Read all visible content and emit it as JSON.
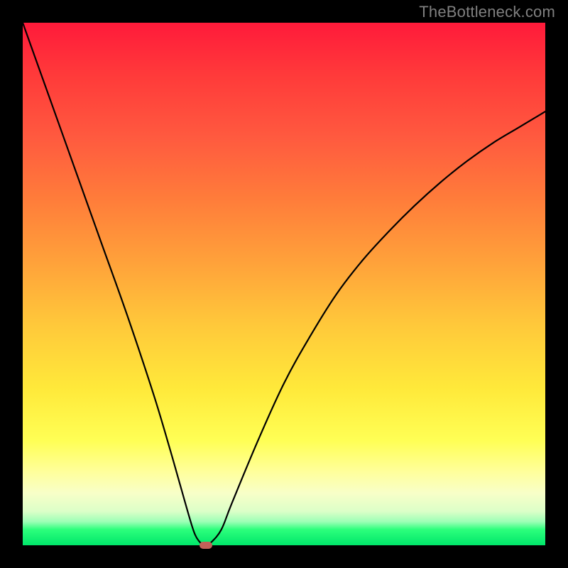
{
  "watermark": "TheBottleneck.com",
  "colors": {
    "background": "#000000",
    "gradient_top": "#ff1a3a",
    "gradient_bottom": "#00e66a",
    "curve_stroke": "#000000",
    "marker_fill": "#c26059",
    "watermark_text": "#808080"
  },
  "chart_data": {
    "type": "line",
    "title": "",
    "xlabel": "",
    "ylabel": "",
    "xlim": [
      0,
      100
    ],
    "ylim": [
      0,
      100
    ],
    "grid": false,
    "legend": false,
    "series": [
      {
        "name": "bottleneck-curve",
        "x": [
          0,
          5,
          10,
          15,
          20,
          25,
          28,
          30,
          32,
          33,
          34,
          35,
          36,
          38,
          40,
          45,
          50,
          55,
          60,
          65,
          70,
          75,
          80,
          85,
          90,
          95,
          100
        ],
        "values": [
          100,
          86,
          72,
          58,
          44,
          29,
          19,
          12,
          5,
          2,
          0.5,
          0,
          0.5,
          3,
          8,
          20,
          31,
          40,
          48,
          54.5,
          60,
          65,
          69.5,
          73.5,
          77,
          80,
          83
        ]
      }
    ],
    "annotations": [
      {
        "name": "minimum",
        "x": 35,
        "y": 0,
        "marker": "rounded-rect"
      }
    ]
  }
}
